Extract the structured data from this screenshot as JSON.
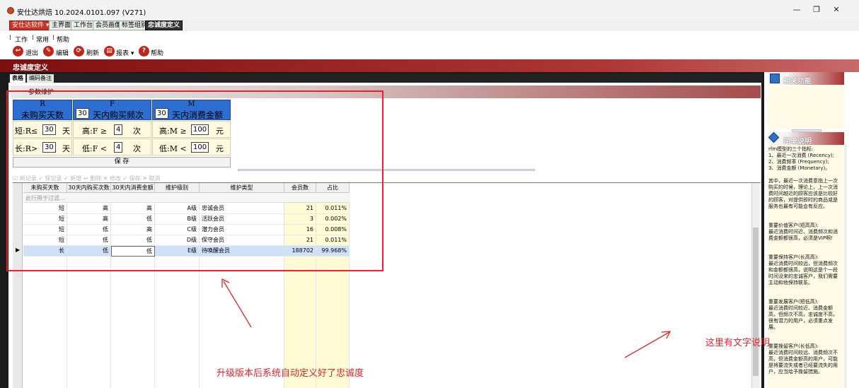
{
  "window": {
    "title": "安仕达烘焙  10.2024.0101.097  (V271)",
    "controls": {
      "minimize": "—",
      "restore": "❐",
      "close": "✕"
    }
  },
  "top_tabs": [
    {
      "label": "安仕达软件 ▾"
    },
    {
      "label": "主界面"
    },
    {
      "label": "工作台"
    },
    {
      "label": "会员画像"
    },
    {
      "label": "标签组别"
    },
    {
      "label": "忠诚度定义"
    }
  ],
  "menu": [
    "工作",
    "常用",
    "帮助"
  ],
  "toolbar": {
    "exit": "退出",
    "edit": "编辑",
    "refresh": "刷新",
    "report": "报表 ▾",
    "help": "帮助"
  },
  "page": {
    "title": "忠诚度定义",
    "subtabs": [
      "表格",
      "编码备注"
    ],
    "params_header": "参数维护"
  },
  "params": {
    "r": {
      "letter": "R",
      "title": "未购买天数",
      "short_label": "短:R≤",
      "short_value": "30",
      "short_unit": "天",
      "long_label": "长:R>",
      "long_value": "30",
      "long_unit": "天"
    },
    "f": {
      "letter": "F",
      "period_value": "30",
      "title": "天内购买频次",
      "high_label": "高:F  ≥",
      "high_value": "4",
      "high_unit": "次",
      "low_label": "低:F  <",
      "low_value": "4",
      "low_unit": "次"
    },
    "m": {
      "letter": "M",
      "period_value": "30",
      "title": "天内消费金额",
      "high_label": "高:M  ≥",
      "high_value": "100",
      "high_unit": "元",
      "low_label": "低:M  <",
      "low_value": "100",
      "low_unit": "元"
    },
    "save_label": "保 存"
  },
  "grid_toolbar": "☑ 新记录 ✓ 保记录 ✓ 新增 ↩ 删除 ✕ 修改 ✓ 保存 ✕ 取消",
  "grid": {
    "columns": [
      "未购买天数",
      "30天内购买次数",
      "30天内消费金额",
      "维护级别",
      "维护类型",
      "会员数",
      "占比"
    ],
    "filter_placeholder": "此行用于过滤...",
    "rows": [
      {
        "r": "短",
        "f": "高",
        "m": "高",
        "level": "A级",
        "type": "忠诚会员",
        "count": "21",
        "pct": "0.011%"
      },
      {
        "r": "短",
        "f": "高",
        "m": "低",
        "level": "B级",
        "type": "活跃会员",
        "count": "3",
        "pct": "0.002%"
      },
      {
        "r": "短",
        "f": "低",
        "m": "高",
        "level": "C级",
        "type": "潜力会员",
        "count": "16",
        "pct": "0.008%"
      },
      {
        "r": "短",
        "f": "低",
        "m": "低",
        "level": "D级",
        "type": "保守会员",
        "count": "21",
        "pct": "0.011%"
      },
      {
        "r": "长",
        "f": "低",
        "m": "低",
        "level": "E级",
        "type": "待唤醒会员",
        "count": "188702",
        "pct": "99.968%"
      }
    ],
    "current_row_marker": "▶"
  },
  "right_panel": {
    "related_title": "相关功能",
    "desc_title": "简单说明",
    "desc_lines": [
      "rfm模型的三个指标:",
      "1、最近一次消费 (Recency);",
      "2、消费频率 (Frequency);",
      "3、消费金额 (Monetary)。",
      "",
      "其中，最近一次消费意指上一次",
      "购买的时候，理论上，上一次消",
      "费时间越近的顾客应该是比较好",
      "的顾客，对提供即时的商品或是",
      "服务也最有可能会有反应。",
      "",
      "",
      "重要价值客户(短高高):",
      "最近消费时间近、消费频次和消",
      "费金额都很高，必须是VIP啊!",
      "",
      "",
      "重要保持客户(长高高):",
      "最近消费时间较远，但消费频次",
      "和金额都很高，说明这是个一段",
      "时间没来的忠诚客户，我们需要",
      "主动和他保持联系。",
      "",
      "",
      "重要发展客户(短低高):",
      "最近消费时间较近、消费金额",
      "高，但频次不高，忠诚度不高，",
      "很有潜力的用户，必须重点发",
      "展。",
      "",
      "",
      "重要挽留客户(长低高):",
      "最近消费时间较远、消费频次不",
      "高，但消费金额高的用户，可能",
      "是将要流失或者已经要流失的用",
      "户，应当给予挽留措施。"
    ]
  },
  "annotations": {
    "bottom_text": "升级版本后系统自动定义好了忠诚度",
    "right_text": "这里有文字说明",
    "color": "#e8232b"
  }
}
